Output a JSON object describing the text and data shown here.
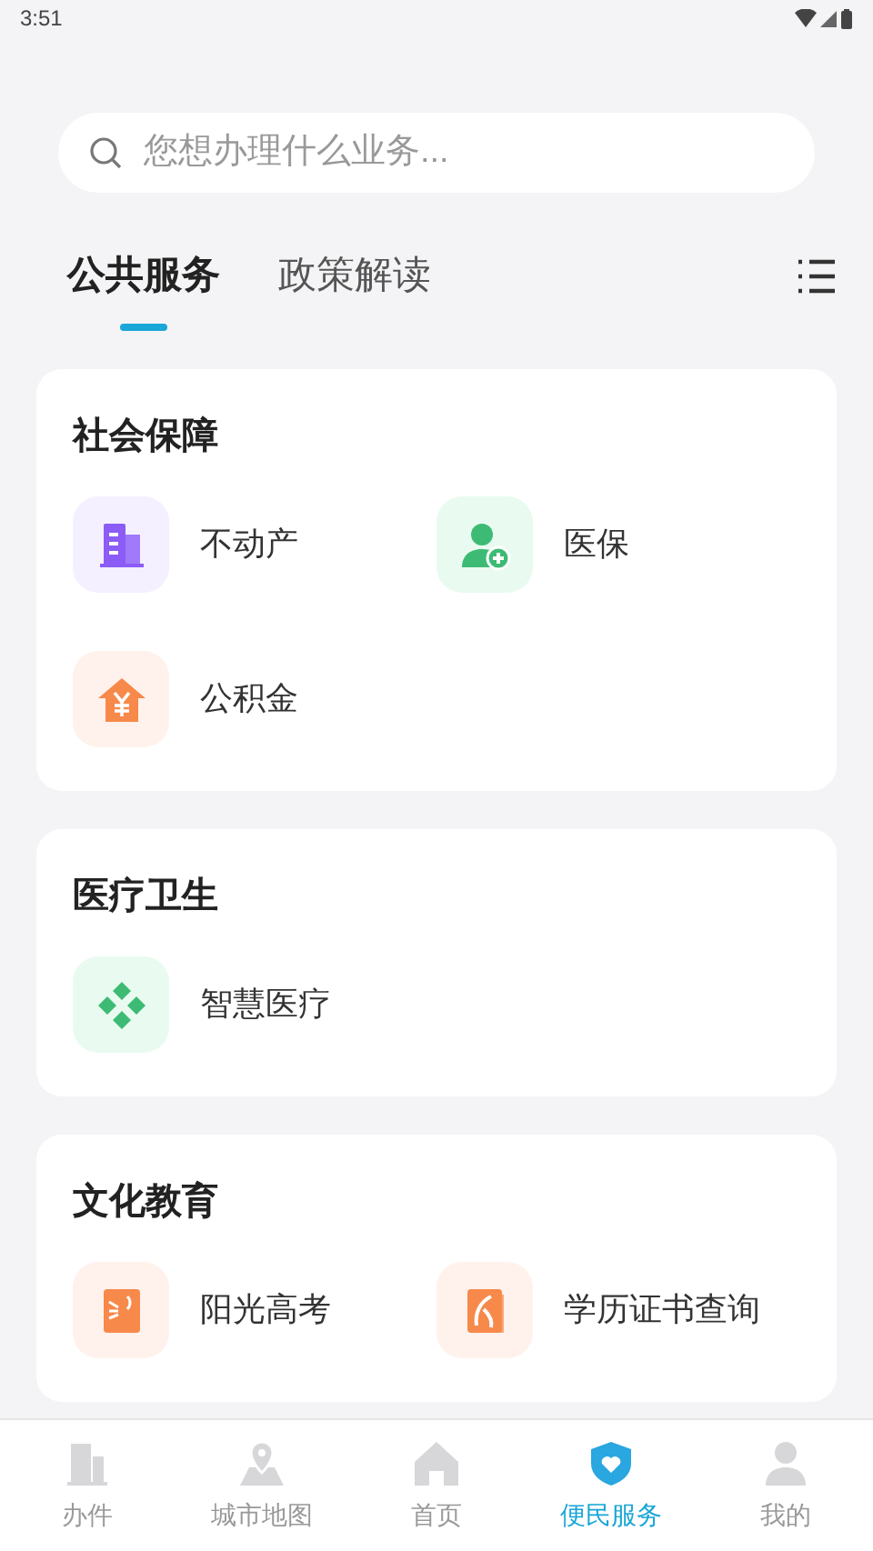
{
  "status_bar": {
    "time": "3:51"
  },
  "search": {
    "placeholder": "您想办理什么业务..."
  },
  "tabs": [
    {
      "label": "公共服务",
      "selected": true
    },
    {
      "label": "政策解读",
      "selected": false
    }
  ],
  "sections": [
    {
      "title": "社会保障",
      "items": [
        {
          "label": "不动产",
          "color": "#8b5cf6"
        },
        {
          "label": "医保",
          "color": "#3dbb74"
        },
        {
          "label": "公积金",
          "color": "#f7894a"
        }
      ]
    },
    {
      "title": "医疗卫生",
      "items": [
        {
          "label": "智慧医疗",
          "color": "#3dbb74"
        }
      ]
    },
    {
      "title": "文化教育",
      "items": [
        {
          "label": "阳光高考",
          "color": "#f7894a"
        },
        {
          "label": "学历证书查询",
          "color": "#f7894a"
        }
      ]
    }
  ],
  "bottom_nav": [
    {
      "label": "办件",
      "selected": false
    },
    {
      "label": "城市地图",
      "selected": false
    },
    {
      "label": "首页",
      "selected": false
    },
    {
      "label": "便民服务",
      "selected": true
    },
    {
      "label": "我的",
      "selected": false
    }
  ]
}
